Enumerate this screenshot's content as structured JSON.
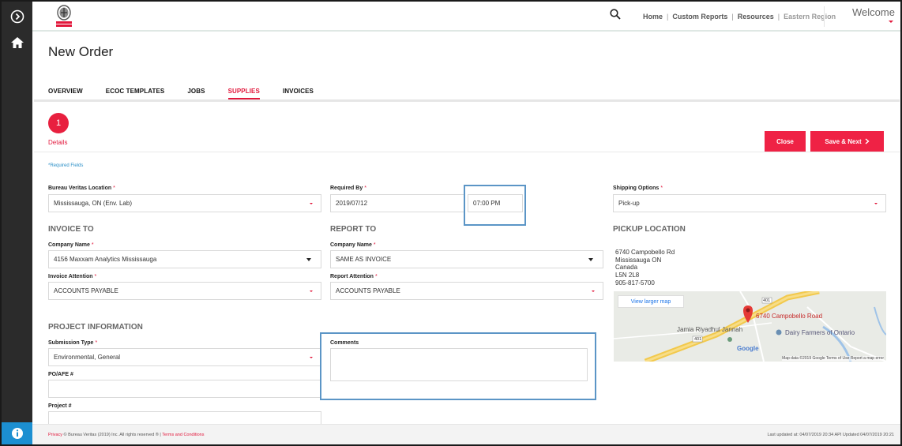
{
  "header": {
    "nav": [
      "Home",
      "Custom Reports",
      "Resources",
      "Eastern Region"
    ],
    "welcome": "Welcome"
  },
  "icons": {
    "toggle": "chevron-right-circle-icon",
    "home": "home-icon",
    "info": "info-icon",
    "search": "search-icon",
    "logo": "bureau-veritas-logo"
  },
  "page": {
    "title": "New Order"
  },
  "tabs": [
    {
      "label": "OVERVIEW",
      "active": false
    },
    {
      "label": "ECOC TEMPLATES",
      "active": false
    },
    {
      "label": "JOBS",
      "active": false
    },
    {
      "label": "SUPPLIES",
      "active": true
    },
    {
      "label": "INVOICES",
      "active": false
    }
  ],
  "step": {
    "number": "1",
    "label": "Details"
  },
  "buttons": {
    "close": "Close",
    "save_next": "Save & Next"
  },
  "form": {
    "required_note": "*Required Fields",
    "bv_location": {
      "label": "Bureau Veritas Location",
      "value": "Mississauga, ON (Env. Lab)"
    },
    "required_by": {
      "label": "Required By",
      "date": "2019/07/12",
      "time": "07:00 PM"
    },
    "shipping": {
      "label": "Shipping Options",
      "value": "Pick-up"
    },
    "invoice_to": {
      "heading": "INVOICE TO",
      "company_label": "Company Name",
      "company_value": "4156 Maxxam Analytics Mississauga",
      "attention_label": "Invoice Attention",
      "attention_value": "ACCOUNTS PAYABLE"
    },
    "report_to": {
      "heading": "REPORT TO",
      "company_label": "Company Name",
      "company_value": "SAME AS INVOICE",
      "attention_label": "Report Attention",
      "attention_value": "ACCOUNTS PAYABLE"
    },
    "pickup": {
      "heading": "PICKUP LOCATION",
      "address": [
        "6740 Campobello Rd",
        "Mississauga ON",
        "Canada",
        "L5N 2L8",
        "905-817-5700"
      ]
    },
    "map": {
      "view_larger": "View larger map",
      "pin_label": "6740 Campobello Road",
      "poi_1": "Jamia Riyadhul Jannah",
      "poi_2": "Dairy Farmers of Ontario",
      "road_401": "401",
      "brand": "Google",
      "footer": "Map data ©2019 Google   Terms of Use   Report a map error"
    },
    "project": {
      "heading": "PROJECT INFORMATION",
      "submission_label": "Submission Type",
      "submission_value": "Environmental, General",
      "po_label": "PO/AFE #",
      "project_label": "Project #",
      "comments_label": "Comments"
    }
  },
  "footer": {
    "privacy": "Privacy",
    "copyright": " © Bureau Veritas (2019) Inc. All rights reserved ® | ",
    "terms": "Terms and Conditions",
    "updated": "Last updated at: 04/07/2019 20:34 API Updated 04/07/2019 20:21"
  },
  "colors": {
    "accent": "#e2173b",
    "highlight": "#5b95c6",
    "rail": "#2b2b2b",
    "info": "#1c8fd1"
  }
}
